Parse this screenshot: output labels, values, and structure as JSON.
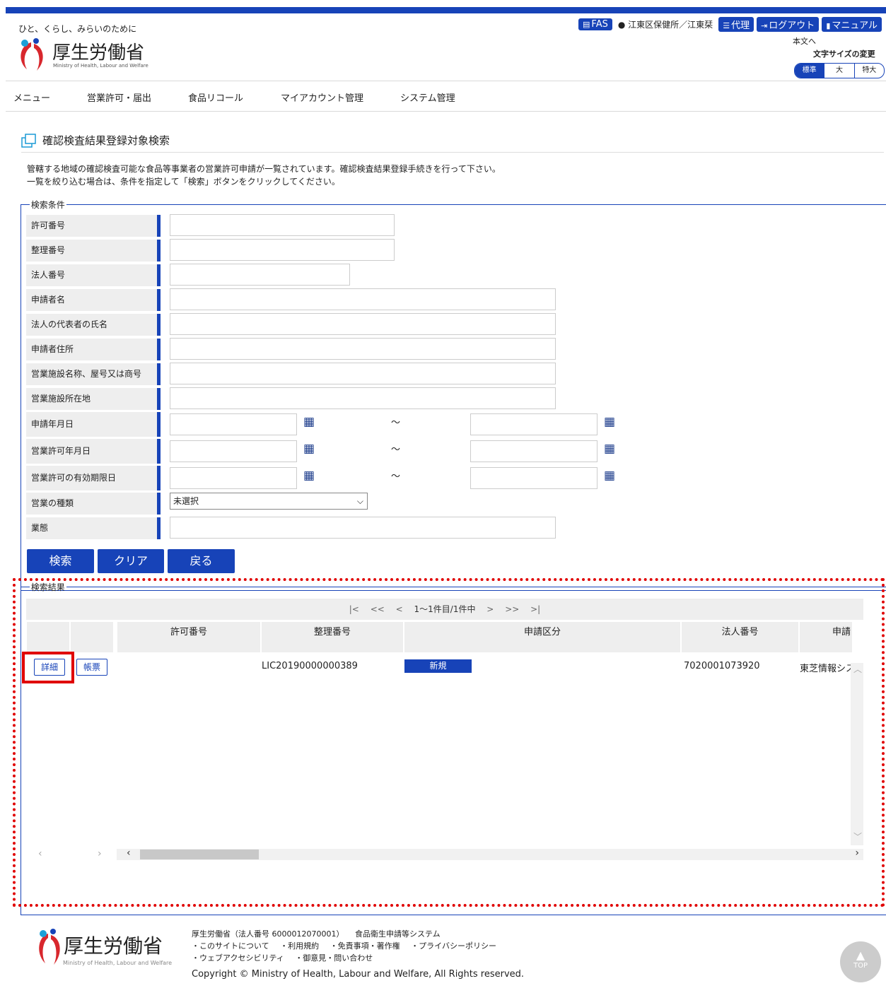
{
  "header": {
    "tagline": "ひと、くらし、みらいのために",
    "logo_ja": "厚生労働省",
    "logo_en": "Ministry of Health, Labour and Welfare",
    "fas_label": "FAS",
    "org_label": "江東区保健所／江東栞",
    "proxy_label": "代理",
    "logout_label": "ログアウト",
    "manual_label": "マニュアル",
    "skip_link": "本文へ",
    "font_size_label": "文字サイズの変更",
    "font_sizes": [
      "標準",
      "大",
      "特大"
    ]
  },
  "nav": {
    "items": [
      "メニュー",
      "営業許可・届出",
      "食品リコール",
      "マイアカウント管理",
      "システム管理"
    ]
  },
  "page": {
    "title": "確認検査結果登録対象検索",
    "desc_line1": "管轄する地域の確認検査可能な食品等事業者の営業許可申請が一覧されています。確認検査結果登録手続きを行って下さい。",
    "desc_line2": "一覧を絞り込む場合は、条件を指定して「検索」ボタンをクリックしてください。"
  },
  "search": {
    "legend": "検索条件",
    "fields": [
      "許可番号",
      "整理番号",
      "法人番号",
      "申請者名",
      "法人の代表者の氏名",
      "申請者住所",
      "営業施設名称、屋号又は商号",
      "営業施設所在地",
      "申請年月日",
      "営業許可年月日",
      "営業許可の有効期限日",
      "営業の種類",
      "業態"
    ],
    "range_separator": "～",
    "business_type_selected": "未選択",
    "buttons": {
      "search": "検索",
      "clear": "クリア",
      "back": "戻る"
    }
  },
  "results": {
    "legend": "検索結果",
    "pager": {
      "first": "|<",
      "prev2": "<<",
      "prev": "<",
      "count": "1～1件目/1件中",
      "next": ">",
      "next2": ">>",
      "last": ">|"
    },
    "columns": [
      "許可番号",
      "整理番号",
      "申請区分",
      "法人番号",
      "申請"
    ],
    "row": {
      "detail_button": "詳細",
      "form_button": "帳票",
      "permit_no": "",
      "ref_no": "LIC20190000000389",
      "category": "新規",
      "corp_no": "7020001073920",
      "applicant": "東芝情報シス"
    }
  },
  "footer": {
    "logo_ja": "厚生労働省",
    "logo_en": "Ministry of Health, Labour and Welfare",
    "org_line": "厚生労働省（法人番号 6000012070001）",
    "system_link": "食品衛生申請等システム",
    "links_row1": [
      "・このサイトについて",
      "・利用規約",
      "・免責事項・著作権",
      "・プライバシーポリシー"
    ],
    "links_row2": [
      "・ウェブアクセシビリティ",
      "・御意見・問い合わせ"
    ],
    "copyright": "Copyright © Ministry of Health, Labour and Welfare, All Rights reserved.",
    "top_label": "TOP"
  }
}
